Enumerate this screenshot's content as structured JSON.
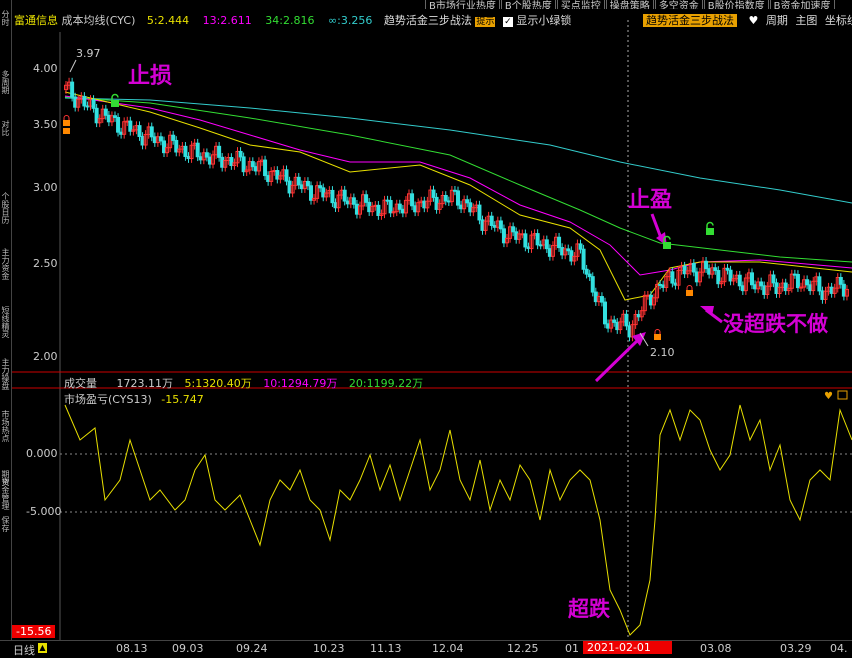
{
  "top_tabs": [
    "B市场行业热度",
    "B个股热度",
    "买点监控",
    "操盘策略",
    "多空资金",
    "B股价指数度",
    "B资金加速度"
  ],
  "left_tabs": [
    "分时",
    "多周期",
    "对比",
    "",
    "个股日历",
    "主力资金",
    "短线精灵",
    "主力操盘",
    "市场热点",
    "期货",
    "资金管理",
    "保存"
  ],
  "header": {
    "stock_name": "富通信息",
    "indicator": "成本均线(CYC)",
    "ma5": "5:2.444",
    "ma13": "13:2.611",
    "ma34": "34:2.816",
    "mainf": "∞:3.256",
    "strategy_label": "趋势活金三步战法",
    "tip_badge": "提示",
    "checkbox_label": "显示小绿锁",
    "strategy_button": "趋势活金三步战法",
    "period_label": "周期",
    "main_chart_label": "主图",
    "axis_label": "坐标线"
  },
  "price_axis": [
    "4.00",
    "3.50",
    "3.00",
    "2.50",
    "2.00"
  ],
  "price_marks": {
    "high": "3.97",
    "low": "2.10"
  },
  "volume_bar": {
    "label": "成交量",
    "value": "1723.11万",
    "ma5": "5:1320.40万",
    "ma10": "10:1294.79万",
    "ma20": "20:1199.22万"
  },
  "oscillator": {
    "title": "市场盈亏(CYS13)",
    "value": "-15.747",
    "axis": [
      "0.000",
      "-5.000"
    ],
    "min_label": "-15.56"
  },
  "annotations": {
    "stop_loss": "止损",
    "take_profit": "止盈",
    "no_trade": "没超跌不做",
    "oversold": "超跌"
  },
  "status": {
    "period": "日线",
    "dates": [
      "08.13",
      "09.03",
      "09.24",
      "10.23",
      "11.13",
      "12.04",
      "12.25",
      "01",
      "03.08",
      "03.29",
      "04."
    ],
    "cursor_date": "2021-02-01"
  },
  "colors": {
    "up": "#ff3333",
    "down": "#33e0e0",
    "ma5": "#e8e8e8",
    "ma13": "#ff00ff",
    "ma34": "#33dd33",
    "ma_long": "#33cccc",
    "ma_yellow": "#e8e000",
    "annotation": "#d400d4",
    "lock_green": "#33dd33",
    "lock_orange": "#ff8800"
  },
  "chart_data": {
    "type": "line",
    "title": "",
    "y_price_range": [
      1.95,
      4.15
    ],
    "candles_close_samples": [
      3.85,
      3.72,
      3.62,
      3.55,
      3.48,
      3.42,
      3.38,
      3.35,
      3.3,
      3.22,
      3.15,
      3.1,
      3.05,
      3.02,
      3.05,
      3.08,
      3.1,
      2.95,
      2.85,
      2.8,
      2.75,
      2.7,
      2.25,
      2.2,
      2.45,
      2.58,
      2.6,
      2.55,
      2.5,
      2.48,
      2.52,
      2.45,
      2.5
    ]
  }
}
